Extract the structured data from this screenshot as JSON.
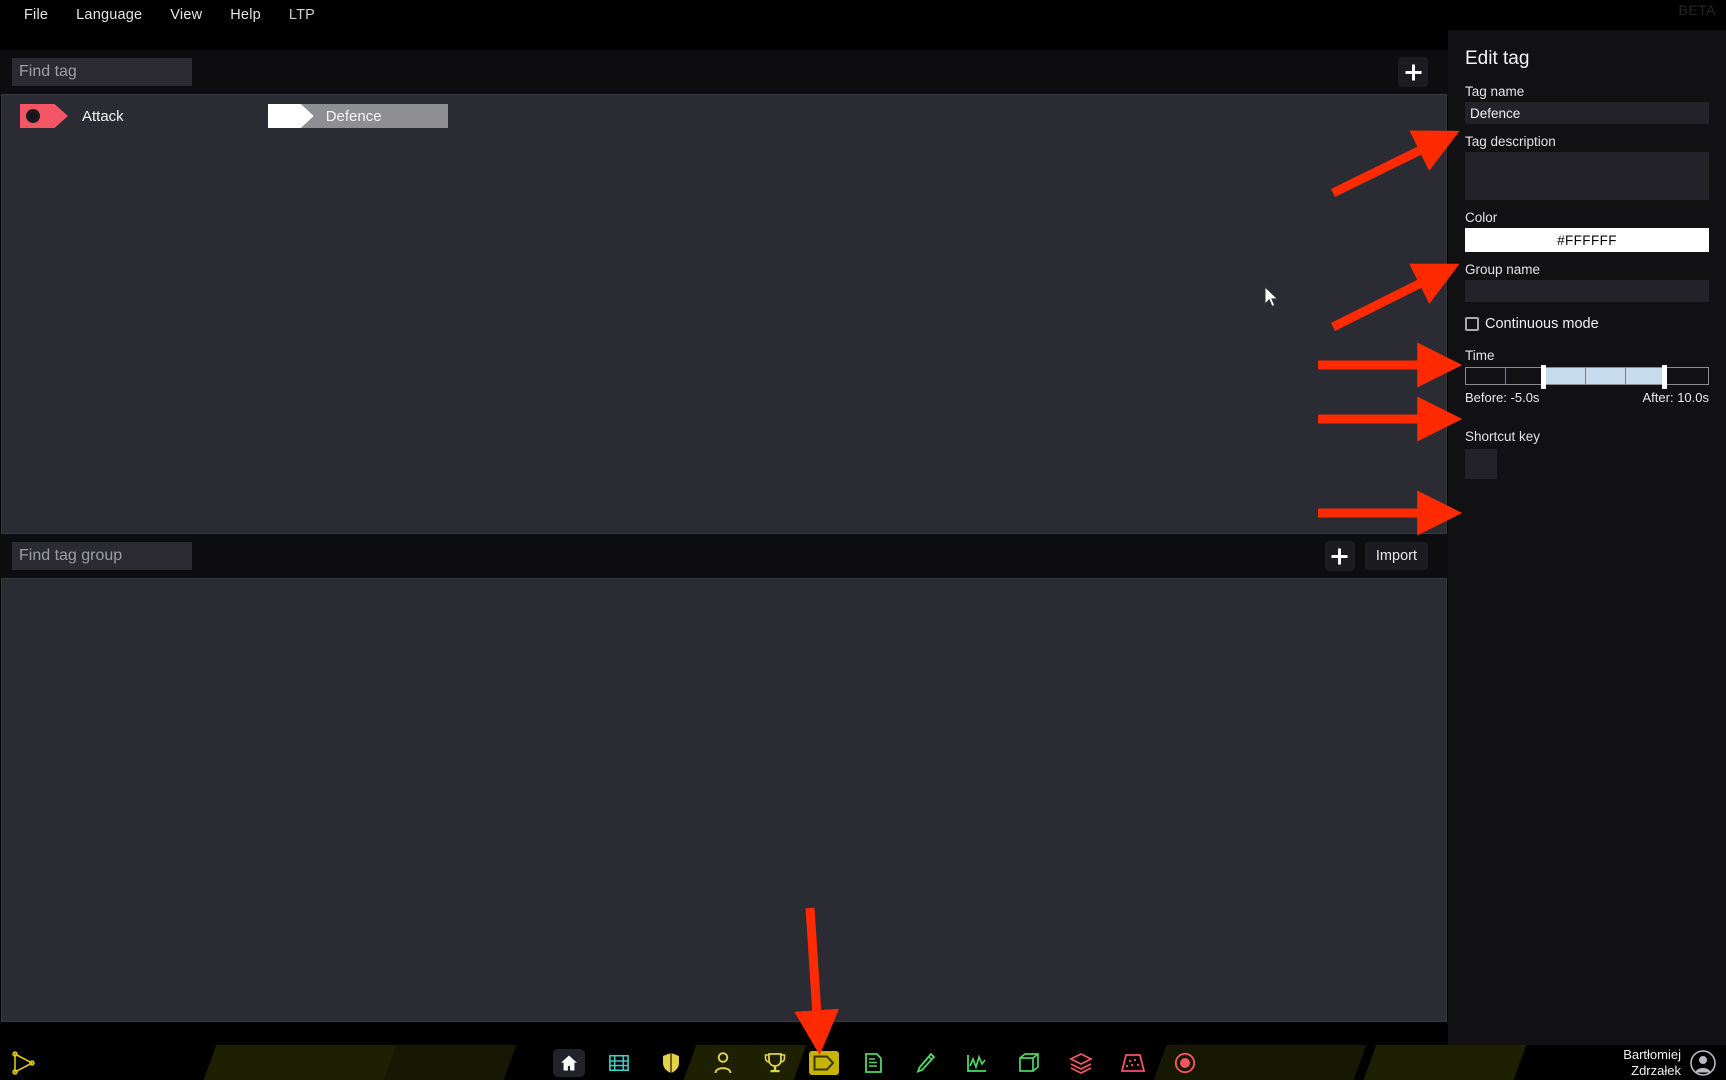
{
  "app": {
    "beta_badge": "BETA"
  },
  "menubar": {
    "items": [
      {
        "label": "File"
      },
      {
        "label": "Language"
      },
      {
        "label": "View"
      },
      {
        "label": "Help"
      },
      {
        "label": "LTP"
      }
    ]
  },
  "tags_section": {
    "search_placeholder": "Find tag",
    "add_button_icon": "plus-icon",
    "tags": [
      {
        "name": "Attack",
        "color": "#F25563",
        "selected": false
      },
      {
        "name": "Defence",
        "color": "#FFFFFF",
        "selected": true
      }
    ]
  },
  "groups_section": {
    "search_placeholder": "Find tag group",
    "add_button_icon": "plus-icon",
    "import_label": "Import",
    "groups": []
  },
  "edit_panel": {
    "title": "Edit tag",
    "tag_name_label": "Tag name",
    "tag_name_value": "Defence",
    "tag_description_label": "Tag description",
    "tag_description_value": "",
    "color_label": "Color",
    "color_value": "#FFFFFF",
    "group_name_label": "Group name",
    "group_name_value": "",
    "continuous_mode_label": "Continuous mode",
    "continuous_mode_checked": false,
    "time_label": "Time",
    "time_before_label": "Before: -5.0s",
    "time_after_label": "After: 10.0s",
    "time_before_seconds": -5.0,
    "time_after_seconds": 10.0,
    "shortcut_key_label": "Shortcut key",
    "shortcut_key_value": ""
  },
  "bottom_toolbar": {
    "play_icon": "play-triangle-icon",
    "icons": [
      {
        "name": "home-icon",
        "color": "#FFFFFF",
        "active": true
      },
      {
        "name": "film-icon",
        "color": "#3FD2C7",
        "active": false
      },
      {
        "name": "shield-icon",
        "color": "#E3D34A",
        "active": false
      },
      {
        "name": "person-icon",
        "color": "#E3D34A",
        "active": false
      },
      {
        "name": "trophy-icon",
        "color": "#E3D34A",
        "active": false
      },
      {
        "name": "tag-icon",
        "color": "#C5B406",
        "active": true
      },
      {
        "name": "notes-icon",
        "color": "#4CD964",
        "active": false
      },
      {
        "name": "pen-icon",
        "color": "#4CD964",
        "active": false
      },
      {
        "name": "analytics-icon",
        "color": "#4CD964",
        "active": false
      },
      {
        "name": "cube-icon",
        "color": "#4CD964",
        "active": false
      },
      {
        "name": "layers-icon",
        "color": "#F25563",
        "active": false
      },
      {
        "name": "pitch-icon",
        "color": "#F25563",
        "active": false
      },
      {
        "name": "record-icon",
        "color": "#F25563",
        "active": false
      }
    ],
    "user_name": "Bartłomiej\nZdrzałek",
    "avatar_icon": "user-avatar-icon"
  },
  "annotations": {
    "arrow_color": "#FF2A00",
    "arrows": [
      {
        "target": "tag-name-field"
      },
      {
        "target": "color-field"
      },
      {
        "target": "continuous-mode-checkbox"
      },
      {
        "target": "time-slider"
      },
      {
        "target": "shortcut-key-field"
      },
      {
        "target": "tag-toolbar-icon"
      }
    ]
  }
}
